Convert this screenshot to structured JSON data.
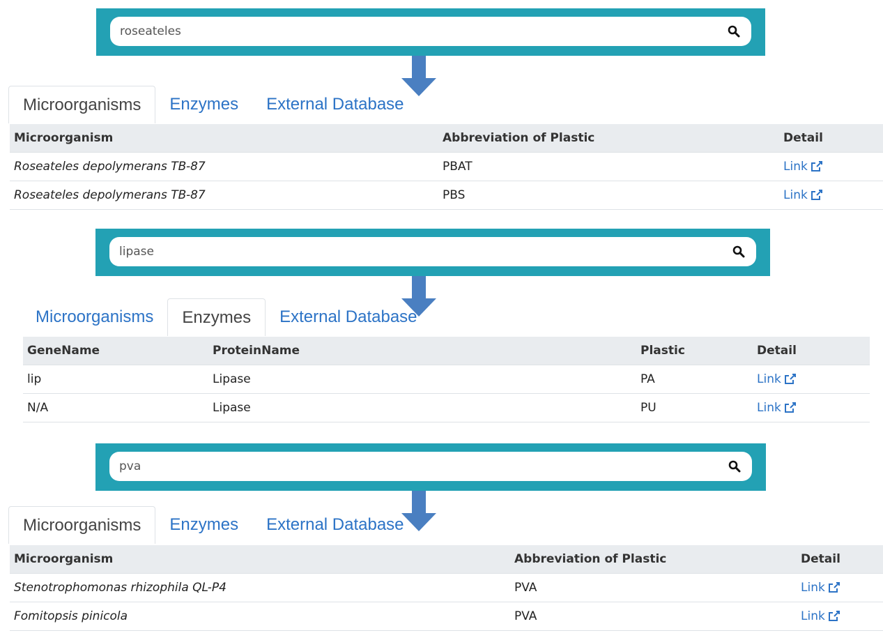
{
  "colors": {
    "banner": "#23a1b4",
    "arrow": "#4a7fc1",
    "link": "#2c73c6",
    "header_bg": "#e9ecef"
  },
  "panel1": {
    "search": {
      "value": "roseateles"
    },
    "tabs": [
      "Microorganisms",
      "Enzymes",
      "External Database"
    ],
    "active_tab": "Microorganisms",
    "columns": [
      "Microorganism",
      "Abbreviation of Plastic",
      "Detail"
    ],
    "rows": [
      {
        "microorganism": "Roseateles depolymerans TB-87",
        "plastic": "PBAT",
        "detail": "Link"
      },
      {
        "microorganism": "Roseateles depolymerans TB-87",
        "plastic": "PBS",
        "detail": "Link"
      }
    ]
  },
  "panel2": {
    "search": {
      "value": "lipase"
    },
    "tabs": [
      "Microorganisms",
      "Enzymes",
      "External Database"
    ],
    "active_tab": "Enzymes",
    "columns": [
      "GeneName",
      "ProteinName",
      "Plastic",
      "Detail"
    ],
    "rows": [
      {
        "gene": "lip",
        "protein": "Lipase",
        "plastic": "PA",
        "detail": "Link"
      },
      {
        "gene": "N/A",
        "protein": "Lipase",
        "plastic": "PU",
        "detail": "Link"
      }
    ]
  },
  "panel3": {
    "search": {
      "value": "pva"
    },
    "tabs": [
      "Microorganisms",
      "Enzymes",
      "External Database"
    ],
    "active_tab": "Microorganisms",
    "columns": [
      "Microorganism",
      "Abbreviation of Plastic",
      "Detail"
    ],
    "rows": [
      {
        "microorganism": "Stenotrophomonas rhizophila QL-P4",
        "plastic": "PVA",
        "detail": "Link"
      },
      {
        "microorganism": "Fomitopsis pinicola",
        "plastic": "PVA",
        "detail": "Link"
      }
    ]
  }
}
